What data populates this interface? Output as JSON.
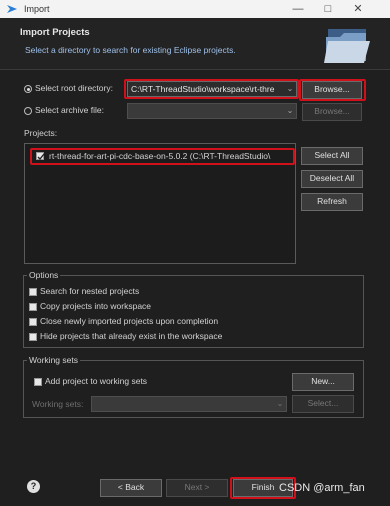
{
  "window": {
    "title": "Import"
  },
  "header": {
    "title": "Import Projects",
    "subtitle": "Select a directory to search for existing Eclipse projects."
  },
  "source": {
    "root_label": "Select root directory:",
    "root_value": "C:\\RT-ThreadStudio\\workspace\\rt-thre",
    "browse_root": "Browse...",
    "archive_label": "Select archive file:",
    "archive_value": "",
    "browse_archive": "Browse..."
  },
  "projects": {
    "label": "Projects:",
    "items": [
      {
        "label": "rt-thread-for-art-pi-cdc-base-on-5.0.2 (C:\\RT-ThreadStudio\\",
        "checked": true
      }
    ],
    "select_all": "Select All",
    "deselect_all": "Deselect All",
    "refresh": "Refresh"
  },
  "options": {
    "title": "Options",
    "items": [
      "Search for nested projects",
      "Copy projects into workspace",
      "Close newly imported projects upon completion",
      "Hide projects that already exist in the workspace"
    ]
  },
  "working_sets": {
    "title": "Working sets",
    "add_label": "Add project to working sets",
    "new_button": "New...",
    "sets_label": "Working sets:",
    "select_button": "Select..."
  },
  "footer": {
    "back": "< Back",
    "next": "Next >",
    "finish": "Finish",
    "watermark": "CSDN @arm_fan"
  },
  "colors": {
    "highlight": "#d0101a",
    "link": "#9fc1ea"
  }
}
